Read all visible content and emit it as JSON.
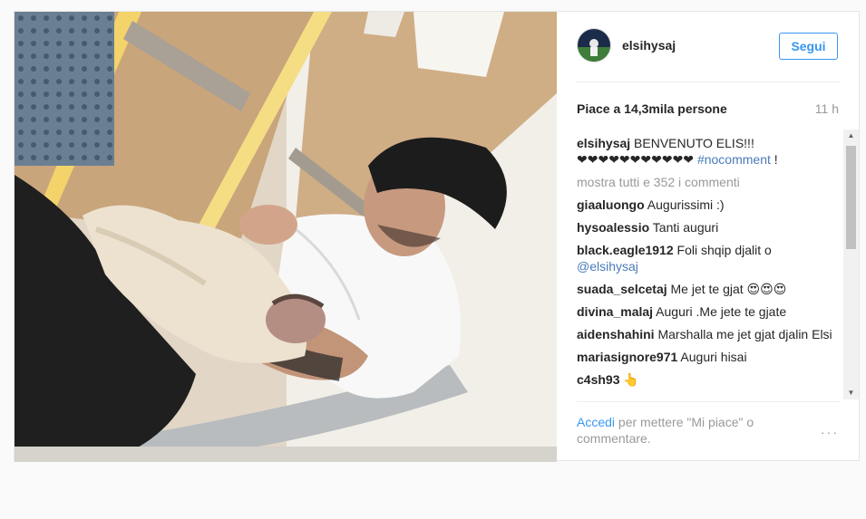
{
  "post": {
    "username": "elsihysaj",
    "follow_label": "Segui",
    "likes": "Piace a 14,3mila persone",
    "time": "11 h",
    "caption": {
      "user": "elsihysaj",
      "text": "BENVENUTO ELIS!!!",
      "hearts": "❤❤❤❤❤❤❤❤❤❤❤",
      "hashtag": "#nocomment",
      "suffix": " !"
    },
    "show_all": "mostra tutti e 352 i commenti",
    "comments": [
      {
        "user": "giaaluongo",
        "text": "Augurissimi :)",
        "mention": ""
      },
      {
        "user": "hysoalessio",
        "text": "Tanti auguri",
        "mention": ""
      },
      {
        "user": "black.eagle1912",
        "text": "Foli shqip djalit o",
        "mention": "@elsihysaj"
      },
      {
        "user": "suada_selcetaj",
        "text": "Me jet te gjat 😍😍😍",
        "mention": ""
      },
      {
        "user": "divina_malaj",
        "text": "Auguri .Me jete te gjate",
        "mention": ""
      },
      {
        "user": "aidenshahini",
        "text": "Marshalla me jet gjat djalin Elsi",
        "mention": ""
      },
      {
        "user": "mariasignore971",
        "text": "Auguri hisai",
        "mention": ""
      },
      {
        "user": "c4sh93",
        "text": "👆",
        "mention": ""
      }
    ],
    "footer": {
      "login": "Accedi",
      "rest": " per mettere \"Mi piace\" o commentare."
    },
    "more_icon": "···"
  },
  "colors": {
    "accent": "#3897f0",
    "muted": "#999999",
    "text": "#262626"
  }
}
